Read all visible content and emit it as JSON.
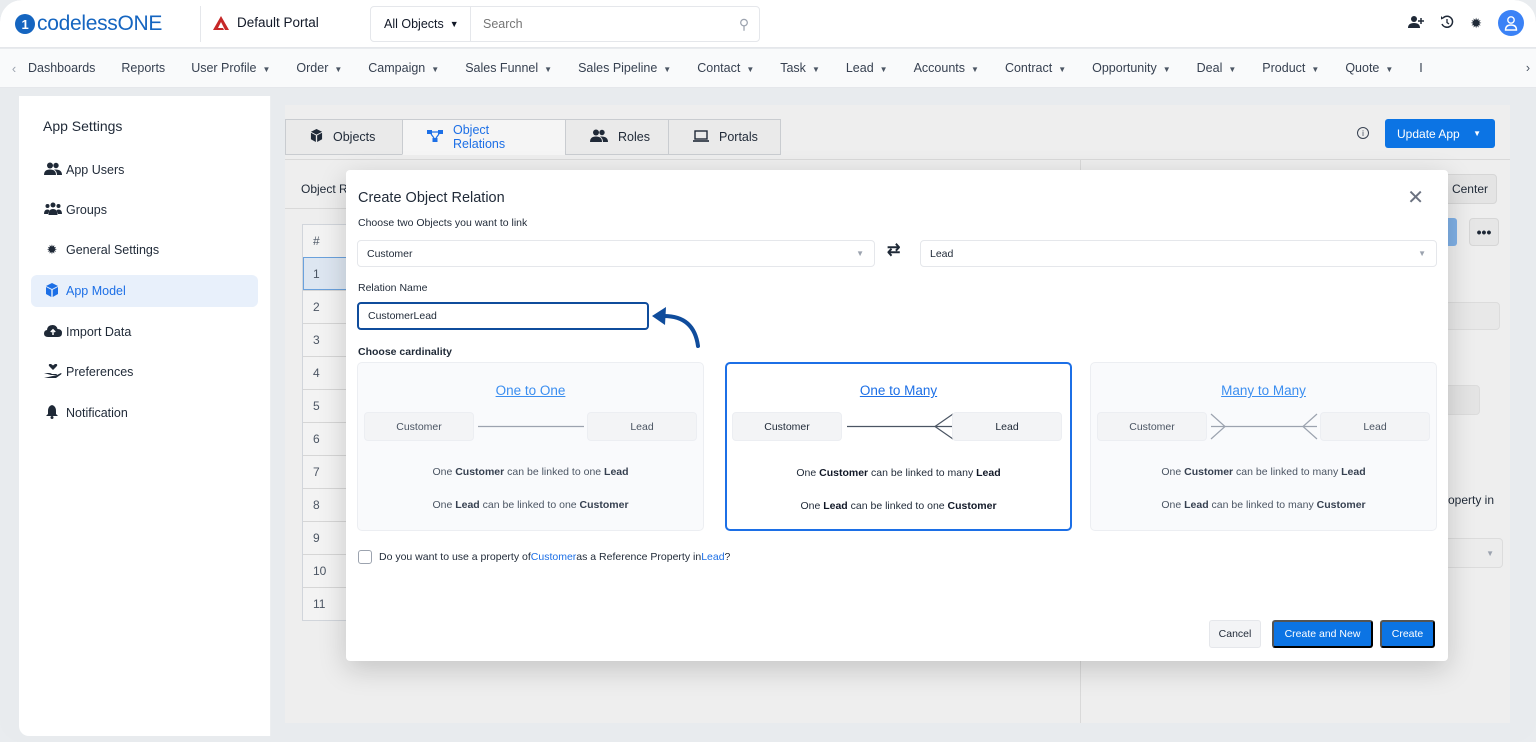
{
  "topbar": {
    "logo_mark": "1",
    "logo_text": "codeless",
    "logo_text_strong": "ONE",
    "portal_name": "Default Portal",
    "search_scope": "All Objects",
    "search_placeholder": "Search",
    "icons": [
      "add-user-icon",
      "history-icon",
      "gear-icon",
      "user-avatar-icon"
    ]
  },
  "navbar": {
    "items": [
      {
        "label": "Dashboards",
        "dropdown": false
      },
      {
        "label": "Reports",
        "dropdown": false
      },
      {
        "label": "User Profile",
        "dropdown": true
      },
      {
        "label": "Order",
        "dropdown": true
      },
      {
        "label": "Campaign",
        "dropdown": true
      },
      {
        "label": "Sales Funnel",
        "dropdown": true
      },
      {
        "label": "Sales Pipeline",
        "dropdown": true
      },
      {
        "label": "Contact",
        "dropdown": true
      },
      {
        "label": "Task",
        "dropdown": true
      },
      {
        "label": "Lead",
        "dropdown": true
      },
      {
        "label": "Accounts",
        "dropdown": true
      },
      {
        "label": "Contract",
        "dropdown": true
      },
      {
        "label": "Opportunity",
        "dropdown": true
      },
      {
        "label": "Deal",
        "dropdown": true
      },
      {
        "label": "Product",
        "dropdown": true
      },
      {
        "label": "Quote",
        "dropdown": true
      }
    ],
    "overflow_label": "I"
  },
  "sidebar": {
    "title": "App Settings",
    "items": [
      {
        "label": "App Users",
        "icon": "users-icon",
        "active": false
      },
      {
        "label": "Groups",
        "icon": "groups-icon",
        "active": false
      },
      {
        "label": "General Settings",
        "icon": "gear-icon",
        "active": false
      },
      {
        "label": "App Model",
        "icon": "cube-icon",
        "active": true
      },
      {
        "label": "Import Data",
        "icon": "cloud-upload-icon",
        "active": false
      },
      {
        "label": "Preferences",
        "icon": "hand-heart-icon",
        "active": false
      },
      {
        "label": "Notification",
        "icon": "bell-icon",
        "active": false
      }
    ]
  },
  "main": {
    "tabs": [
      {
        "label": "Objects",
        "icon": "cube-icon",
        "active": false
      },
      {
        "label": "Object Relations",
        "icon": "relations-icon",
        "active": true
      },
      {
        "label": "Roles",
        "icon": "users-icon",
        "active": false
      },
      {
        "label": "Portals",
        "icon": "laptop-icon",
        "active": false
      }
    ],
    "update_button": "Update App",
    "section_label": "Object R",
    "help_center_label": "Center",
    "more_label": "•••",
    "table_header": "#",
    "table_rows": [
      "1",
      "2",
      "3",
      "4",
      "5",
      "6",
      "7",
      "8",
      "9",
      "10",
      "11"
    ],
    "background_text": "operty in"
  },
  "modal": {
    "title": "Create Object Relation",
    "subtitle": "Choose two Objects you want to link",
    "object_left": "Customer",
    "object_right": "Lead",
    "relation_name_label": "Relation Name",
    "relation_name_value": "CustomerLead",
    "cardinality_label": "Choose cardinality",
    "selected_cardinality": "One to Many",
    "cards": [
      {
        "title": "One to One",
        "left": "Customer",
        "right": "Lead",
        "line1": {
          "pre": "One ",
          "a": "Customer",
          "mid": " can be linked to one ",
          "b": "Lead"
        },
        "line2": {
          "pre": "One ",
          "a": "Lead",
          "mid": " can be linked to one ",
          "b": "Customer"
        }
      },
      {
        "title": "One to Many",
        "left": "Customer",
        "right": "Lead",
        "line1": {
          "pre": "One ",
          "a": "Customer",
          "mid": " can be linked to many ",
          "b": "Lead"
        },
        "line2": {
          "pre": "One ",
          "a": "Lead",
          "mid": " can be linked to one ",
          "b": "Customer"
        }
      },
      {
        "title": "Many to Many",
        "left": "Customer",
        "right": "Lead",
        "line1": {
          "pre": "One ",
          "a": "Customer",
          "mid": " can be linked to many ",
          "b": "Lead"
        },
        "line2": {
          "pre": "One ",
          "a": "Lead",
          "mid": " can be linked to many ",
          "b": "Customer"
        }
      }
    ],
    "reference_checkbox": {
      "checked": false,
      "pre": "Do you want to use a property of ",
      "obj_a": "Customer",
      "mid": " as a Reference Property in ",
      "obj_b": "Lead",
      "post": "?"
    },
    "buttons": {
      "cancel": "Cancel",
      "create_and_new": "Create and New",
      "create": "Create"
    }
  },
  "colors": {
    "primary": "#0c74e4",
    "active_blue": "#1c6fe6",
    "link_blue": "#3b8ef0",
    "annotation_arrow": "#0f4c9c",
    "brand": "#1565c0"
  }
}
